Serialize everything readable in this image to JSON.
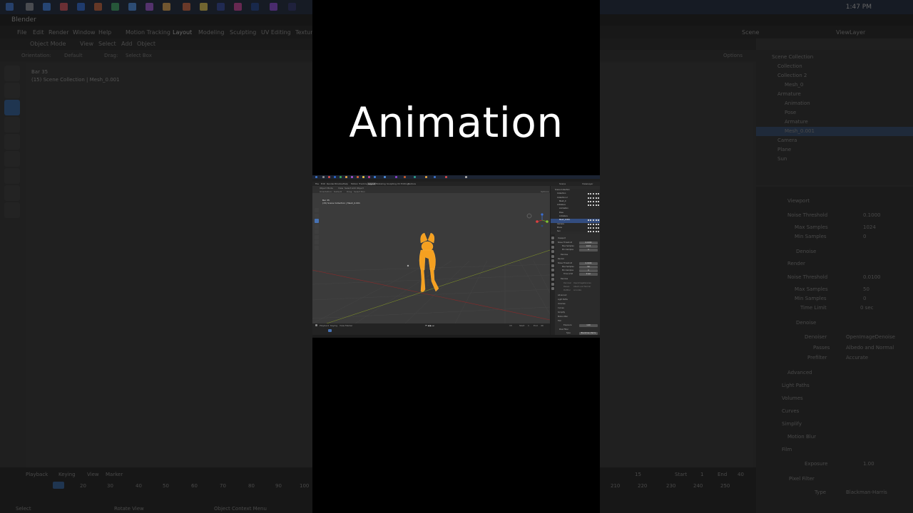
{
  "overlay_title": "Animation",
  "colors": {
    "accent": "#4772b3",
    "selection_orange": "#f5a020",
    "background": "#000000"
  },
  "background_ui": {
    "taskbar_time": "1:47 PM",
    "app_title": "Blender",
    "menu": [
      "File",
      "Edit",
      "Render",
      "Window",
      "Help"
    ],
    "workspace_tabs": [
      "Motion Tracking",
      "Layout",
      "Modeling",
      "Sculpting",
      "UV Editing",
      "Texture"
    ],
    "active_workspace": "Layout",
    "scene_label": "Scene",
    "view_layer_label": "ViewLayer",
    "viewport_header": [
      "Object Mode",
      "View",
      "Select",
      "Add",
      "Object"
    ],
    "tool_header": [
      "Orientation:",
      "Default",
      "Drag:",
      "Select Box"
    ],
    "options_label": "Options",
    "hud_lines": [
      "Bar 35",
      "(15) Scene Collection | Mesh_0.001"
    ],
    "outliner_items": [
      "Scene Collection",
      "Collection",
      "Collection 2",
      "Mesh_0",
      "Armature",
      "Animation",
      "Pose",
      "Armature",
      "Mesh_0.001",
      "Camera",
      "Plane",
      "Sun"
    ],
    "properties": {
      "viewport": {
        "section": "Viewport",
        "noise_threshold_label": "Noise Threshold",
        "noise_threshold": "0.1000",
        "max_samples_label": "Max Samples",
        "max_samples": "1024",
        "min_samples_label": "Min Samples",
        "min_samples": "0"
      },
      "denoise_label": "Denoise",
      "render": {
        "section": "Render",
        "noise_threshold_label": "Noise Threshold",
        "noise_threshold": "0.0100",
        "max_samples_label": "Max Samples",
        "max_samples": "50",
        "min_samples_label": "Min Samples",
        "min_samples": "0",
        "time_limit_label": "Time Limit",
        "time_limit": "0 sec"
      },
      "denoise_section": "Denoise",
      "denoiser_label": "Denoiser",
      "denoiser": "OpenImageDenoise",
      "passes_label": "Passes",
      "passes": "Albedo and Normal",
      "prefilter_label": "Prefilter",
      "prefilter": "Accurate",
      "collapsed_sections": [
        "Advanced",
        "Light Paths",
        "Volumes",
        "Curves",
        "Simplify",
        "Motion Blur",
        "Film"
      ],
      "exposure_label": "Exposure",
      "exposure": "1.00",
      "pixel_filter_label": "Pixel Filter",
      "type_label": "Type",
      "type": "Blackman-Harris"
    },
    "timeline": {
      "menu": [
        "Playback",
        "Keying",
        "View",
        "Marker"
      ],
      "current_frame": "15",
      "start_label": "Start",
      "start": "1",
      "end_label": "End",
      "end": "40",
      "ticks_left": [
        "10",
        "20",
        "30",
        "40",
        "50",
        "60",
        "70",
        "80",
        "90",
        "100"
      ],
      "ticks_right": [
        "210",
        "220",
        "230",
        "240",
        "250"
      ]
    },
    "status_bar": [
      "Select",
      "Rotate View",
      "Object Context Menu"
    ]
  }
}
